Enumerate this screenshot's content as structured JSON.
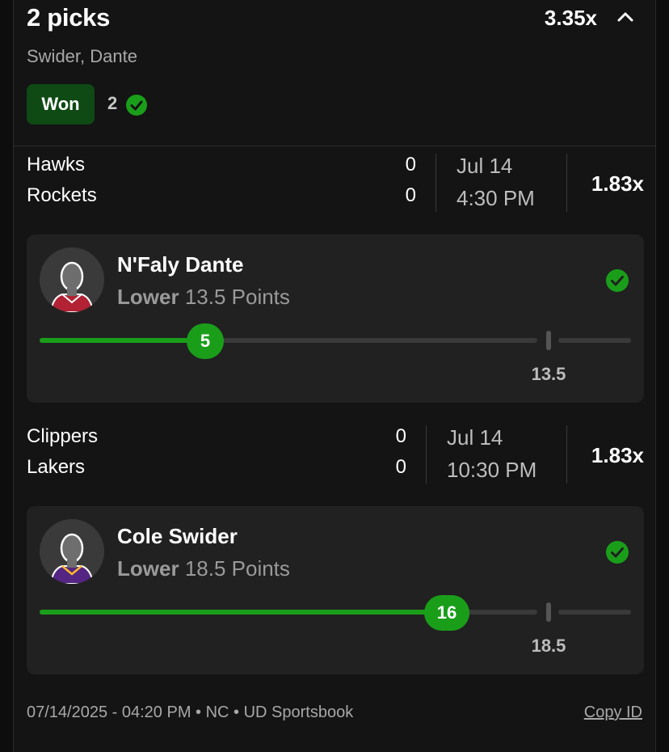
{
  "header": {
    "title": "2 picks",
    "multiplier": "3.35x",
    "subtitle": "Swider, Dante",
    "status_badge": "Won",
    "won_count": "2"
  },
  "games": [
    {
      "team1": "Hawks",
      "team2": "Rockets",
      "score1": "0",
      "score2": "0",
      "date": "Jul 14",
      "time": "4:30 PM",
      "multiplier": "1.83x",
      "pick": {
        "player": "N'Faly Dante",
        "direction": "Lower",
        "stat_line": "13.5 Points",
        "actual": "5",
        "line": "13.5",
        "progress_fraction": 0.37,
        "jersey_color": "#b22234"
      }
    },
    {
      "team1": "Clippers",
      "team2": "Lakers",
      "score1": "0",
      "score2": "0",
      "date": "Jul 14",
      "time": "10:30 PM",
      "multiplier": "1.83x",
      "pick": {
        "player": "Cole Swider",
        "direction": "Lower",
        "stat_line": "18.5 Points",
        "actual": "16",
        "line": "18.5",
        "progress_fraction": 0.86,
        "jersey_color": "#552583"
      }
    }
  ],
  "footer": {
    "meta": "07/14/2025 - 04:20 PM • NC • UD Sportsbook",
    "copy_label": "Copy ID"
  },
  "colors": {
    "accent_green": "#1a9e1a",
    "won_badge_bg": "#0f4a14",
    "background": "#141414"
  },
  "icons": [
    "chevron-up-icon",
    "check-circle-icon",
    "player-silhouette-icon"
  ]
}
